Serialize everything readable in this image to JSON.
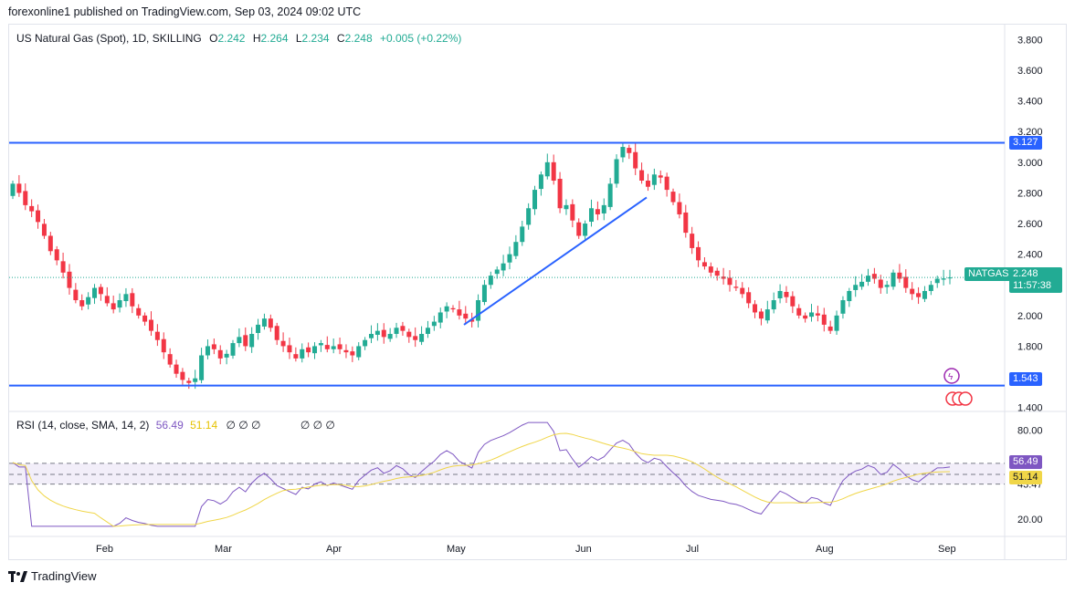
{
  "header": {
    "publisher": "forexonline1 published on TradingView.com, Sep 03, 2024 09:02 UTC"
  },
  "legend": {
    "symbol": "US Natural Gas (Spot), 1D, SKILLING",
    "o_label": "O",
    "o": "2.242",
    "h_label": "H",
    "h": "2.264",
    "l_label": "L",
    "l": "2.234",
    "c_label": "C",
    "c": "2.248",
    "change": "+0.005 (+0.22%)"
  },
  "rsi_legend": {
    "label": "RSI (14, close, SMA, 14, 2)",
    "rsi_value": "56.49",
    "sma_value": "51.14",
    "placeholders": "∅ ∅ ∅",
    "placeholders2": "∅ ∅ ∅"
  },
  "price_tags": {
    "resistance": "3.127",
    "support": "1.543",
    "symbol_tag": "NATGAS",
    "last_price": "2.248",
    "countdown": "11:57:38"
  },
  "rsi_tags": {
    "rsi": "56.49",
    "sma": "51.14"
  },
  "footer": {
    "brand": "TradingView"
  },
  "colors": {
    "up": "#22ab94",
    "down": "#f23645",
    "line": "#2962ff",
    "rsi": "#7e57c2",
    "sma": "#f0d648",
    "band": "#ede7f6"
  },
  "chart_data": [
    {
      "type": "candlestick",
      "title": "US Natural Gas (Spot), 1D, SKILLING",
      "yticks": [
        "3.800",
        "3.600",
        "3.400",
        "3.200",
        "3.000",
        "2.800",
        "2.600",
        "2.400",
        "2.200",
        "2.000",
        "1.800",
        "1.600",
        "1.400"
      ],
      "ylim": [
        1.38,
        3.88
      ],
      "xticks": [
        "Feb",
        "Mar",
        "Apr",
        "May",
        "Jun",
        "Jul",
        "Aug",
        "Sep"
      ],
      "horizontal_lines": [
        3.127,
        1.543
      ],
      "trendline": {
        "from": [
          "2024-05-01",
          1.94
        ],
        "to": [
          "2024-06-17",
          2.77
        ]
      },
      "last_close": 2.248,
      "close": [
        2.86,
        2.8,
        2.72,
        2.68,
        2.61,
        2.52,
        2.42,
        2.36,
        2.28,
        2.18,
        2.1,
        2.06,
        2.12,
        2.18,
        2.14,
        2.08,
        2.04,
        2.1,
        2.14,
        2.06,
        2.0,
        1.96,
        1.9,
        1.84,
        1.76,
        1.68,
        1.62,
        1.58,
        1.56,
        1.59,
        1.74,
        1.8,
        1.78,
        1.72,
        1.75,
        1.82,
        1.86,
        1.8,
        1.88,
        1.94,
        1.98,
        1.92,
        1.84,
        1.8,
        1.76,
        1.72,
        1.78,
        1.76,
        1.8,
        1.82,
        1.78,
        1.8,
        1.78,
        1.76,
        1.74,
        1.8,
        1.84,
        1.88,
        1.9,
        1.86,
        1.88,
        1.92,
        1.9,
        1.86,
        1.84,
        1.88,
        1.92,
        1.96,
        2.02,
        2.06,
        2.04,
        2.0,
        1.98,
        1.96,
        2.1,
        2.2,
        2.26,
        2.3,
        2.34,
        2.4,
        2.48,
        2.58,
        2.7,
        2.82,
        2.92,
        3.0,
        2.88,
        2.7,
        2.72,
        2.62,
        2.52,
        2.6,
        2.7,
        2.66,
        2.72,
        2.86,
        3.02,
        3.1,
        3.06,
        2.96,
        2.88,
        2.84,
        2.92,
        2.9,
        2.82,
        2.74,
        2.66,
        2.54,
        2.44,
        2.36,
        2.32,
        2.28,
        2.26,
        2.24,
        2.2,
        2.18,
        2.14,
        2.08,
        2.02,
        1.98,
        2.04,
        2.1,
        2.16,
        2.12,
        2.06,
        2.0,
        1.98,
        2.02,
        2.0,
        1.94,
        1.9,
        2.0,
        2.1,
        2.16,
        2.2,
        2.22,
        2.26,
        2.24,
        2.18,
        2.2,
        2.28,
        2.24,
        2.18,
        2.14,
        2.12,
        2.16,
        2.2,
        2.24,
        2.242,
        2.248
      ],
      "rsi_ylim": [
        10,
        90
      ],
      "rsi_yticks": [
        80,
        57.43,
        43.47,
        20
      ],
      "rsi_band": [
        57.43,
        43.47
      ],
      "rsi_last": 56.49,
      "sma_last": 51.14
    }
  ]
}
